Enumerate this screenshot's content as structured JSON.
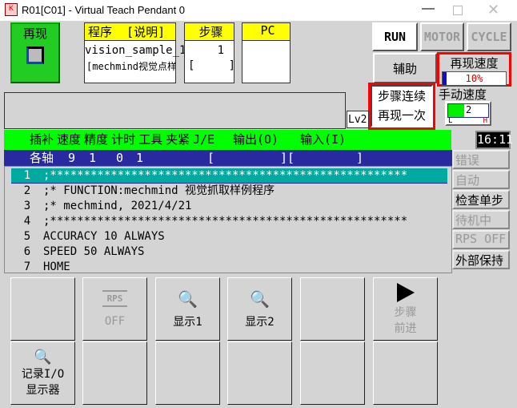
{
  "window": {
    "title": "R01[C01] - Virtual Teach Pendant 0"
  },
  "mode": {
    "label": "再现"
  },
  "program": {
    "header": "程序  [说明]",
    "name": "vision_sample_1",
    "comment": "[mechmind视觉点样例]"
  },
  "step": {
    "header": "步骤",
    "value": "1",
    "sub": "[     ]"
  },
  "pc": {
    "header": "PC"
  },
  "status_buttons": {
    "run": "RUN",
    "motor": "MOTOR",
    "cycle": "CYCLE",
    "aux": "辅助"
  },
  "replay_speed": {
    "label": "再现速度",
    "value": "10%",
    "percent": 10
  },
  "step_mode": {
    "line1": "步骤连续",
    "line2": "再现一次"
  },
  "manual_speed": {
    "label": "手动速度",
    "value": "2",
    "low": "L",
    "high": "H"
  },
  "level": "Lv2",
  "clock": "16:11",
  "green_bar": {
    "items": [
      "插补",
      "速度",
      "精度",
      "计时",
      "工具",
      "夹紧",
      "J/E"
    ],
    "output": "输出(O)",
    "input": "输入(I)"
  },
  "blue_bar": {
    "label": "各轴",
    "values": [
      "9",
      "1",
      "0",
      "1"
    ],
    "bracket1": "[",
    "bracket2": "][",
    "bracket3": "]"
  },
  "side_status": [
    "错误",
    "自动",
    "检查单步",
    "待机中",
    "RPS OFF",
    "外部保持"
  ],
  "program_lines": [
    {
      "no": "1",
      "text": ";*****************************************************"
    },
    {
      "no": "2",
      "text": ";* FUNCTION:mechmind 视觉抓取样例程序"
    },
    {
      "no": "3",
      "text": ";* mechmind, 2021/4/21"
    },
    {
      "no": "4",
      "text": ";*****************************************************"
    },
    {
      "no": "5",
      "text": "ACCURACY 10 ALWAYS"
    },
    {
      "no": "6",
      "text": "SPEED 50 ALWAYS"
    },
    {
      "no": "7",
      "text": "HOME"
    }
  ],
  "function_keys": {
    "rps_icon": "RPS",
    "rps": "OFF",
    "display1": "显示1",
    "display2": "显示2",
    "step_forward_1": "步骤",
    "step_forward_2": "前进",
    "io_1": "记录I/O",
    "io_2": "显示器"
  },
  "colors": {
    "green": "#00ff00",
    "yellow": "#ffff00",
    "blue": "#2a2aa0",
    "teal": "#00aaa0",
    "red": "#ff0000"
  }
}
